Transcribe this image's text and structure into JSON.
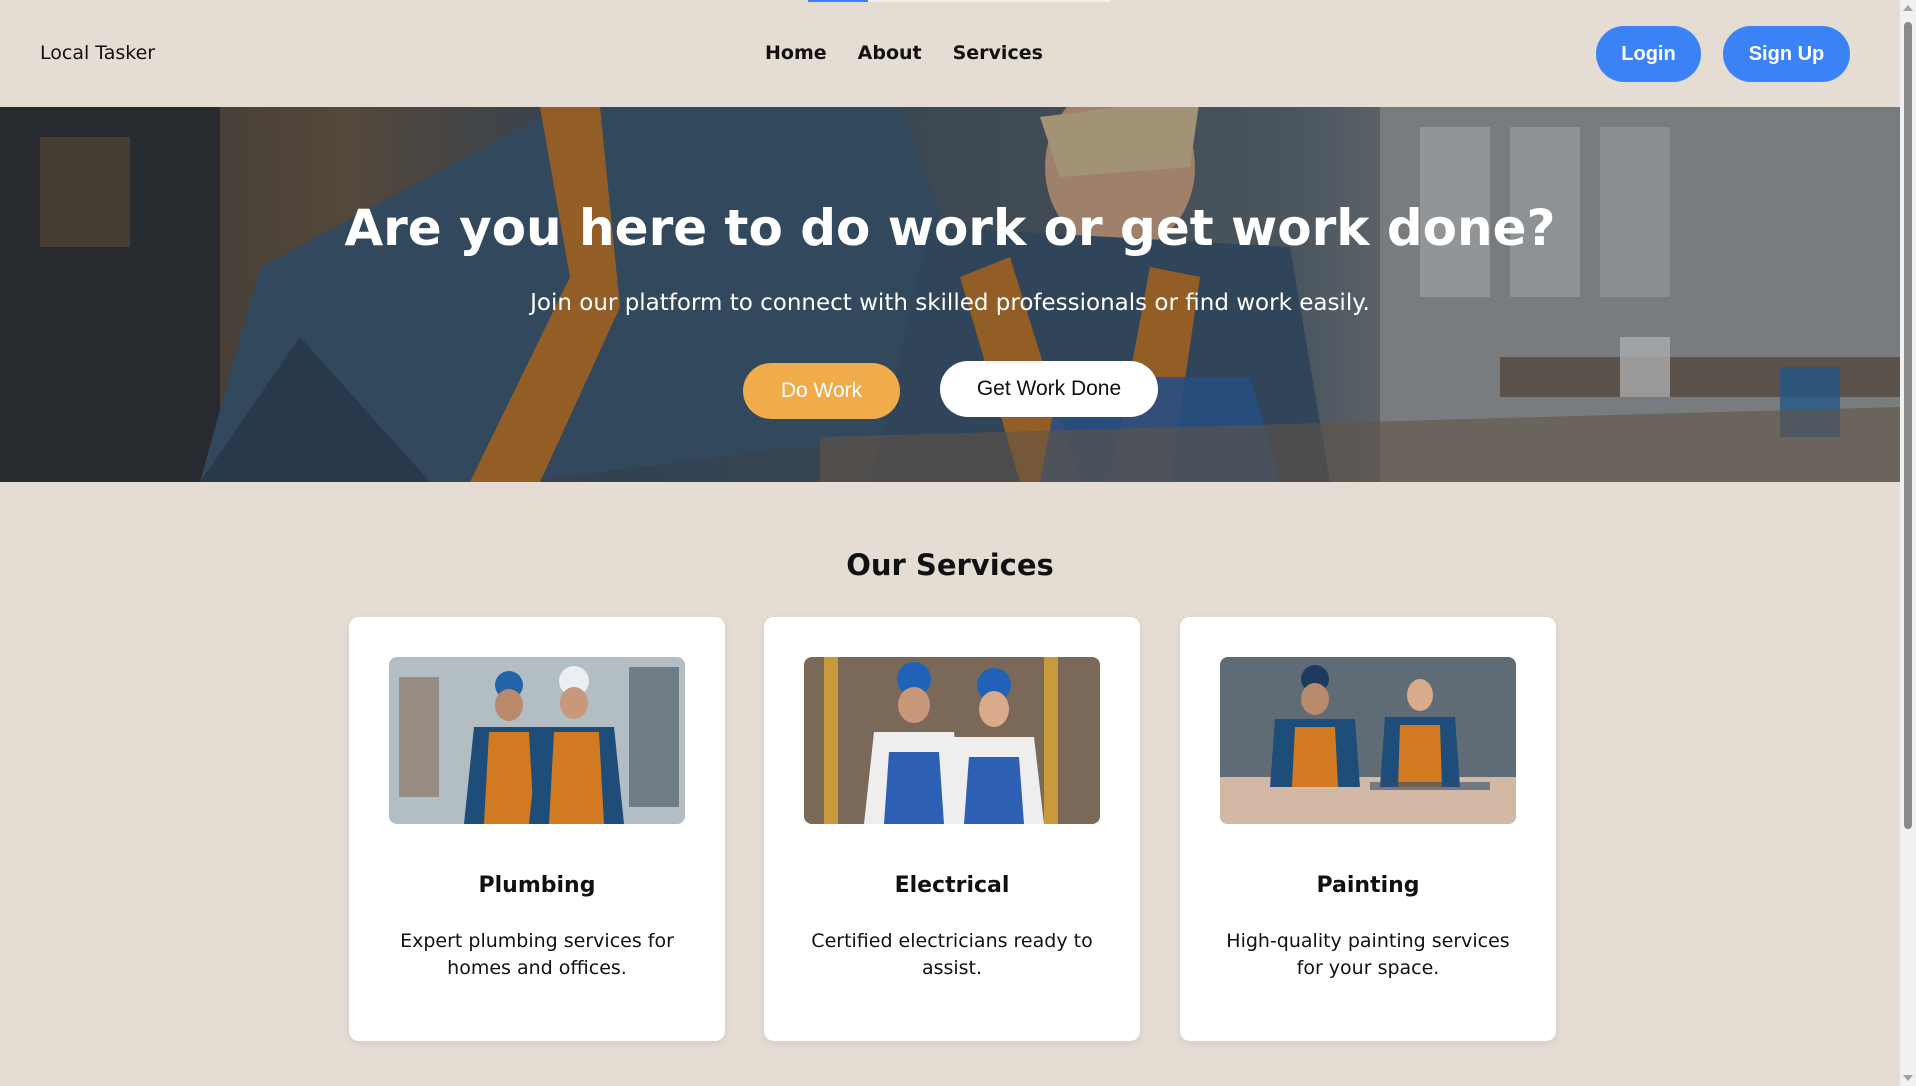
{
  "header": {
    "brand": "Local Tasker",
    "nav": [
      "Home",
      "About",
      "Services"
    ],
    "login_label": "Login",
    "signup_label": "Sign Up"
  },
  "hero": {
    "title": "Are you here to do work or get work done?",
    "subtitle": "Join our platform to connect with skilled professionals or find work easily.",
    "do_work_label": "Do Work",
    "get_work_done_label": "Get Work Done"
  },
  "services": {
    "title": "Our Services",
    "cards": [
      {
        "title": "Plumbing",
        "description": "Expert plumbing services for homes and offices."
      },
      {
        "title": "Electrical",
        "description": "Certified electricians ready to assist."
      },
      {
        "title": "Painting",
        "description": "High-quality painting services for your space."
      }
    ]
  },
  "colors": {
    "page_bg": "#e5dcd3",
    "primary_blue": "#3b82f6",
    "accent_orange": "#f0ab4a"
  }
}
